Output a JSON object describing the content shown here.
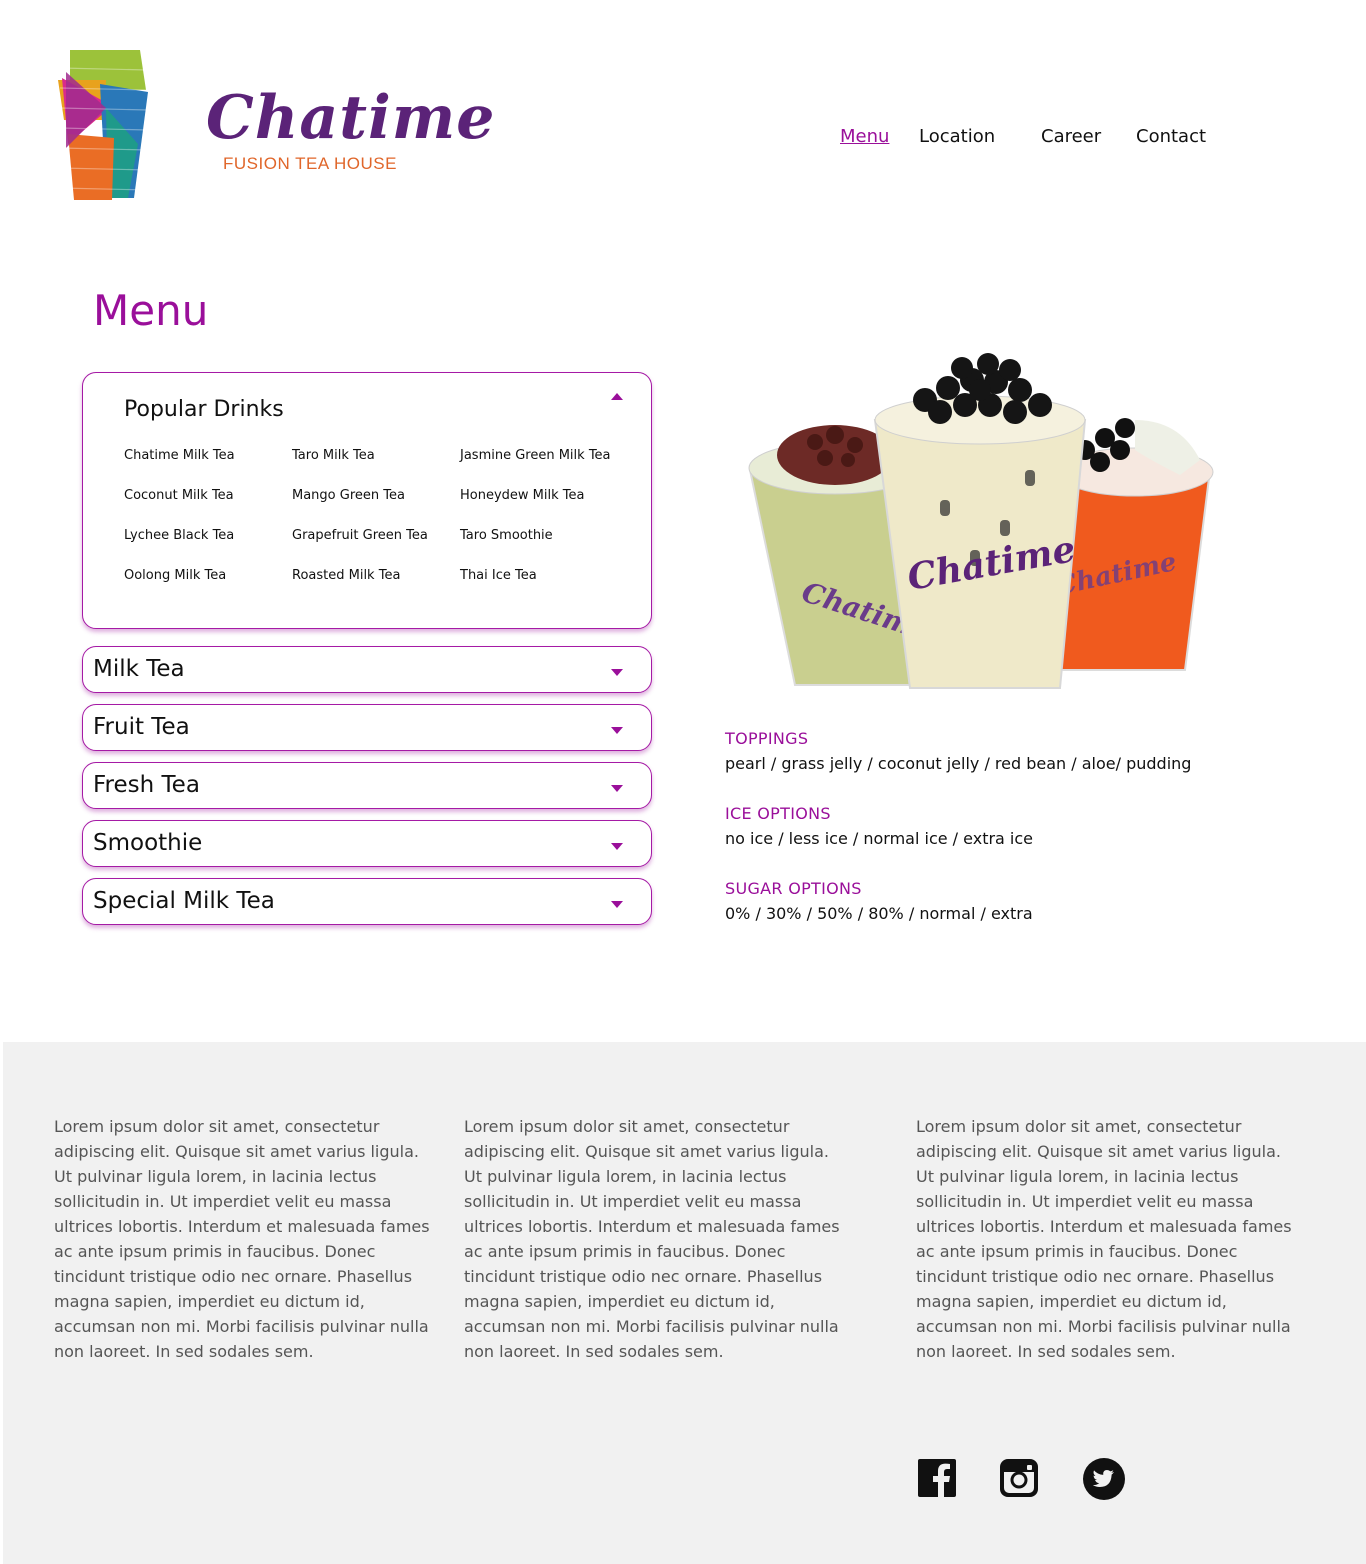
{
  "brand": {
    "name": "Chatime",
    "tagline": "FUSION TEA HOUSE"
  },
  "nav": {
    "items": [
      {
        "label": "Menu",
        "active": true
      },
      {
        "label": "Location",
        "active": false
      },
      {
        "label": "Career",
        "active": false
      },
      {
        "label": "Contact",
        "active": false
      }
    ]
  },
  "page_title": "Menu",
  "accordion": {
    "open_section": {
      "title": "Popular Drinks",
      "drinks": [
        "Chatime Milk Tea",
        "Taro Milk Tea",
        "Jasmine Green Milk Tea",
        "Coconut Milk Tea",
        "Mango Green Tea",
        "Honeydew Milk Tea",
        "Lychee Black Tea",
        "Grapefruit Green Tea",
        "Taro Smoothie",
        "Oolong Milk Tea",
        "Roasted Milk Tea",
        "Thai Ice Tea"
      ]
    },
    "closed_sections": [
      "Milk Tea",
      "Fruit Tea",
      "Fresh Tea",
      "Smoothie",
      "Special Milk Tea"
    ]
  },
  "options": {
    "toppings": {
      "heading": "TOPPINGS",
      "text": "pearl / grass jelly / coconut jelly / red bean / aloe/ pudding"
    },
    "ice": {
      "heading": "ICE OPTIONS",
      "text": "no ice / less ice / normal ice / extra ice"
    },
    "sugar": {
      "heading": "SUGAR OPTIONS",
      "text": "0% / 30% / 50% / 80% / normal / extra"
    }
  },
  "footer": {
    "columns": [
      "Lorem ipsum dolor sit amet, consectetur adipiscing elit. Quisque sit amet varius ligula. Ut pulvinar ligula lorem, in lacinia lectus sollicitudin in. Ut imperdiet velit eu massa ultrices lobortis. Interdum et malesuada fames ac ante ipsum primis in faucibus. Donec tincidunt tristique odio nec ornare. Phasellus magna sapien, imperdiet eu dictum id, accumsan non mi. Morbi facilisis pulvinar nulla non laoreet. In sed sodales sem.",
      "Lorem ipsum dolor sit amet, consectetur adipiscing elit. Quisque sit amet varius ligula. Ut pulvinar ligula lorem, in lacinia lectus sollicitudin in. Ut imperdiet velit eu massa ultrices lobortis. Interdum et malesuada fames ac ante ipsum primis in faucibus. Donec tincidunt tristique odio nec ornare. Phasellus magna sapien, imperdiet eu dictum id, accumsan non mi. Morbi facilisis pulvinar nulla non laoreet. In sed sodales sem.",
      "Lorem ipsum dolor sit amet, consectetur adipiscing elit. Quisque sit amet varius ligula. Ut pulvinar ligula lorem, in lacinia lectus sollicitudin in. Ut imperdiet velit eu massa ultrices lobortis. Interdum et malesuada fames ac ante ipsum primis in faucibus. Donec tincidunt tristique odio nec ornare. Phasellus magna sapien, imperdiet eu dictum id, accumsan non mi. Morbi facilisis pulvinar nulla non laoreet. In sed sodales sem."
    ],
    "social_icons": [
      "facebook-icon",
      "instagram-icon",
      "twitter-icon"
    ]
  },
  "colors": {
    "accent": "#9a0f9a",
    "brand_purple": "#5b2378",
    "tagline_orange": "#e0662a",
    "footer_bg": "#f1f1f1"
  }
}
